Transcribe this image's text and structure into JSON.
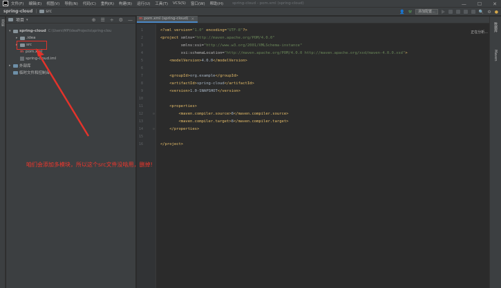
{
  "menubar": {
    "items": [
      "文件(F)",
      "编辑(E)",
      "视图(V)",
      "导航(N)",
      "代码(C)",
      "重构(R)",
      "构建(B)",
      "运行(U)",
      "工具(T)",
      "VCS(S)",
      "窗口(W)",
      "帮助(H)"
    ],
    "window_title": "spring-cloud - pom.xml (spring-cloud)",
    "controls": [
      "—",
      "☐",
      "✕"
    ]
  },
  "navbar": {
    "project": "spring-cloud",
    "folder": "src",
    "add_config_label": "添加配置..."
  },
  "left_stripe": {
    "label": "项目"
  },
  "project_panel": {
    "title": "项目",
    "tree": {
      "root": "spring-cloud",
      "root_path": "C:\\Users\\MP\\IdeaProjects\\spring-clou",
      "idea": ".idea",
      "src": "src",
      "pom": "pom.xml",
      "iml": "spring-cloud.iml",
      "ext_libs": "外部库",
      "scratch": "临时文件和控制台"
    }
  },
  "editor": {
    "tab_label": "pom.xml (spring-cloud)",
    "tab_icon": "m",
    "analyzing": "正在分析...",
    "line_numbers": [
      "1",
      "2",
      "3",
      "4",
      "5",
      "6",
      "7",
      "8",
      "9",
      "10",
      "11",
      "12",
      "13",
      "14",
      "15",
      "16"
    ],
    "code": {
      "l1_a": "<?xml version=",
      "l1_b": "\"1.0\"",
      "l1_c": " encoding=",
      "l1_d": "\"UTF-8\"",
      "l1_e": "?>",
      "l2_a": "<project",
      "l2_b": " xmlns=",
      "l2_c": "\"http://maven.apache.org/POM/4.0.0\"",
      "l3_a": "         xmlns:xsi=",
      "l3_b": "\"http://www.w3.org/2001/XMLSchema-instance\"",
      "l4_a": "         xsi:schemaLocation=",
      "l4_b": "\"http://maven.apache.org/POM/4.0.0 http://maven.apache.org/xsd/maven-4.0.0.xsd\"",
      "l4_c": ">",
      "l5_a": "    <modelVersion>",
      "l5_b": "4.0.0",
      "l5_c": "</modelVersion>",
      "l7_a": "    <groupId>",
      "l7_b": "org.example",
      "l7_c": "</groupId>",
      "l8_a": "    <artifactId>",
      "l8_b": "spring-cloud",
      "l8_c": "</artifactId>",
      "l9_a": "    <version>",
      "l9_b": "1.0-SNAPSHOT",
      "l9_c": "</version>",
      "l11": "    <properties>",
      "l12_a": "        <maven.compiler.source>",
      "l12_b": "8",
      "l12_c": "</maven.compiler.source>",
      "l13_a": "        <maven.compiler.target>",
      "l13_b": "8",
      "l13_c": "</maven.compiler.target>",
      "l14": "    </properties>",
      "l16": "</project>"
    }
  },
  "right_stripe": {
    "label_top": "数据库",
    "label_bottom": "Maven"
  },
  "annotation": {
    "text": "咱们会添加多模块，所以这个src文件没啥用，删掉!"
  },
  "colors": {
    "accent": "#e3332b",
    "tag": "#e8bf6a",
    "value": "#6a8759"
  }
}
